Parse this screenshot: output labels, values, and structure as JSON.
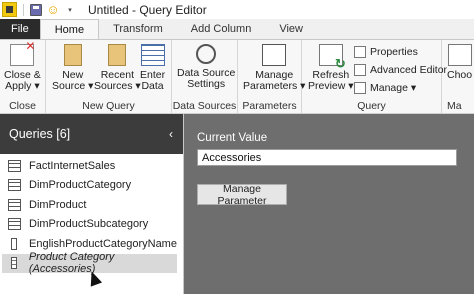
{
  "titlebar": {
    "title": "Untitled - Query Editor"
  },
  "tabs": [
    {
      "label": "File"
    },
    {
      "label": "Home"
    },
    {
      "label": "Transform"
    },
    {
      "label": "Add Column"
    },
    {
      "label": "View"
    }
  ],
  "ribbon": {
    "groups": {
      "close": {
        "label": "Close",
        "close_apply": [
          "Close &",
          "Apply ▾"
        ]
      },
      "new_query": {
        "label": "New Query",
        "new_source": [
          "New",
          "Source ▾"
        ],
        "recent_sources": [
          "Recent",
          "Sources ▾"
        ],
        "enter_data": [
          "Enter",
          "Data"
        ]
      },
      "data_sources": {
        "label": "Data Sources",
        "data_source_settings": [
          "Data Source",
          "Settings"
        ]
      },
      "parameters": {
        "label": "Parameters",
        "manage_parameters": [
          "Manage",
          "Parameters ▾"
        ]
      },
      "query": {
        "label": "Query",
        "refresh_preview": [
          "Refresh",
          "Preview ▾"
        ],
        "properties": "Properties",
        "advanced_editor": "Advanced Editor",
        "manage": "Manage ▾"
      },
      "partial": {
        "choose": "Choo",
        "label": "Ma"
      }
    }
  },
  "queries": {
    "header": "Queries [6]",
    "items": [
      {
        "label": "FactInternetSales",
        "icon": "table-icon"
      },
      {
        "label": "DimProductCategory",
        "icon": "table-icon"
      },
      {
        "label": "DimProduct",
        "icon": "table-icon"
      },
      {
        "label": "DimProductSubcategory",
        "icon": "table-icon"
      },
      {
        "label": "EnglishProductCategoryName",
        "icon": "list-icon"
      },
      {
        "label": "Product Category (Accessories)",
        "icon": "parameter-icon",
        "selected": true
      }
    ]
  },
  "main": {
    "current_value_label": "Current Value",
    "current_value": "Accessories",
    "manage_parameter_button": "Manage Parameter"
  }
}
